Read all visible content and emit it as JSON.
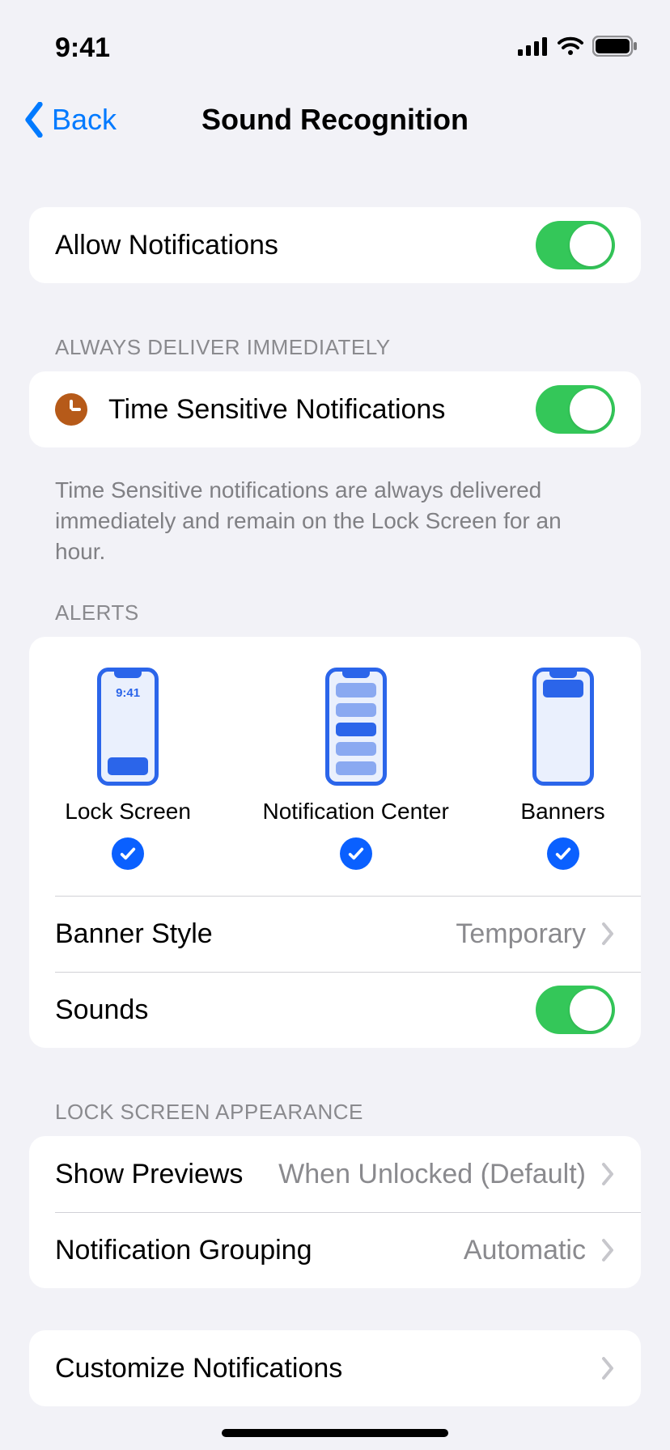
{
  "status": {
    "time": "9:41"
  },
  "nav": {
    "back": "Back",
    "title": "Sound Recognition"
  },
  "allow_notifications": {
    "label": "Allow Notifications",
    "on": true
  },
  "time_sensitive": {
    "header": "Always Deliver Immediately",
    "label": "Time Sensitive Notifications",
    "on": true,
    "footer": "Time Sensitive notifications are always delivered immediately and remain on the Lock Screen for an hour."
  },
  "alerts": {
    "header": "Alerts",
    "options": {
      "lock_screen": {
        "label": "Lock Screen",
        "checked": true,
        "clock": "9:41"
      },
      "notification_center": {
        "label": "Notification Center",
        "checked": true
      },
      "banners": {
        "label": "Banners",
        "checked": true
      }
    },
    "banner_style": {
      "label": "Banner Style",
      "value": "Temporary"
    },
    "sounds": {
      "label": "Sounds",
      "on": true
    }
  },
  "lock_screen_appearance": {
    "header": "Lock Screen Appearance",
    "show_previews": {
      "label": "Show Previews",
      "value": "When Unlocked (Default)"
    },
    "notification_grouping": {
      "label": "Notification Grouping",
      "value": "Automatic"
    }
  },
  "customize_notifications": {
    "label": "Customize Notifications"
  }
}
